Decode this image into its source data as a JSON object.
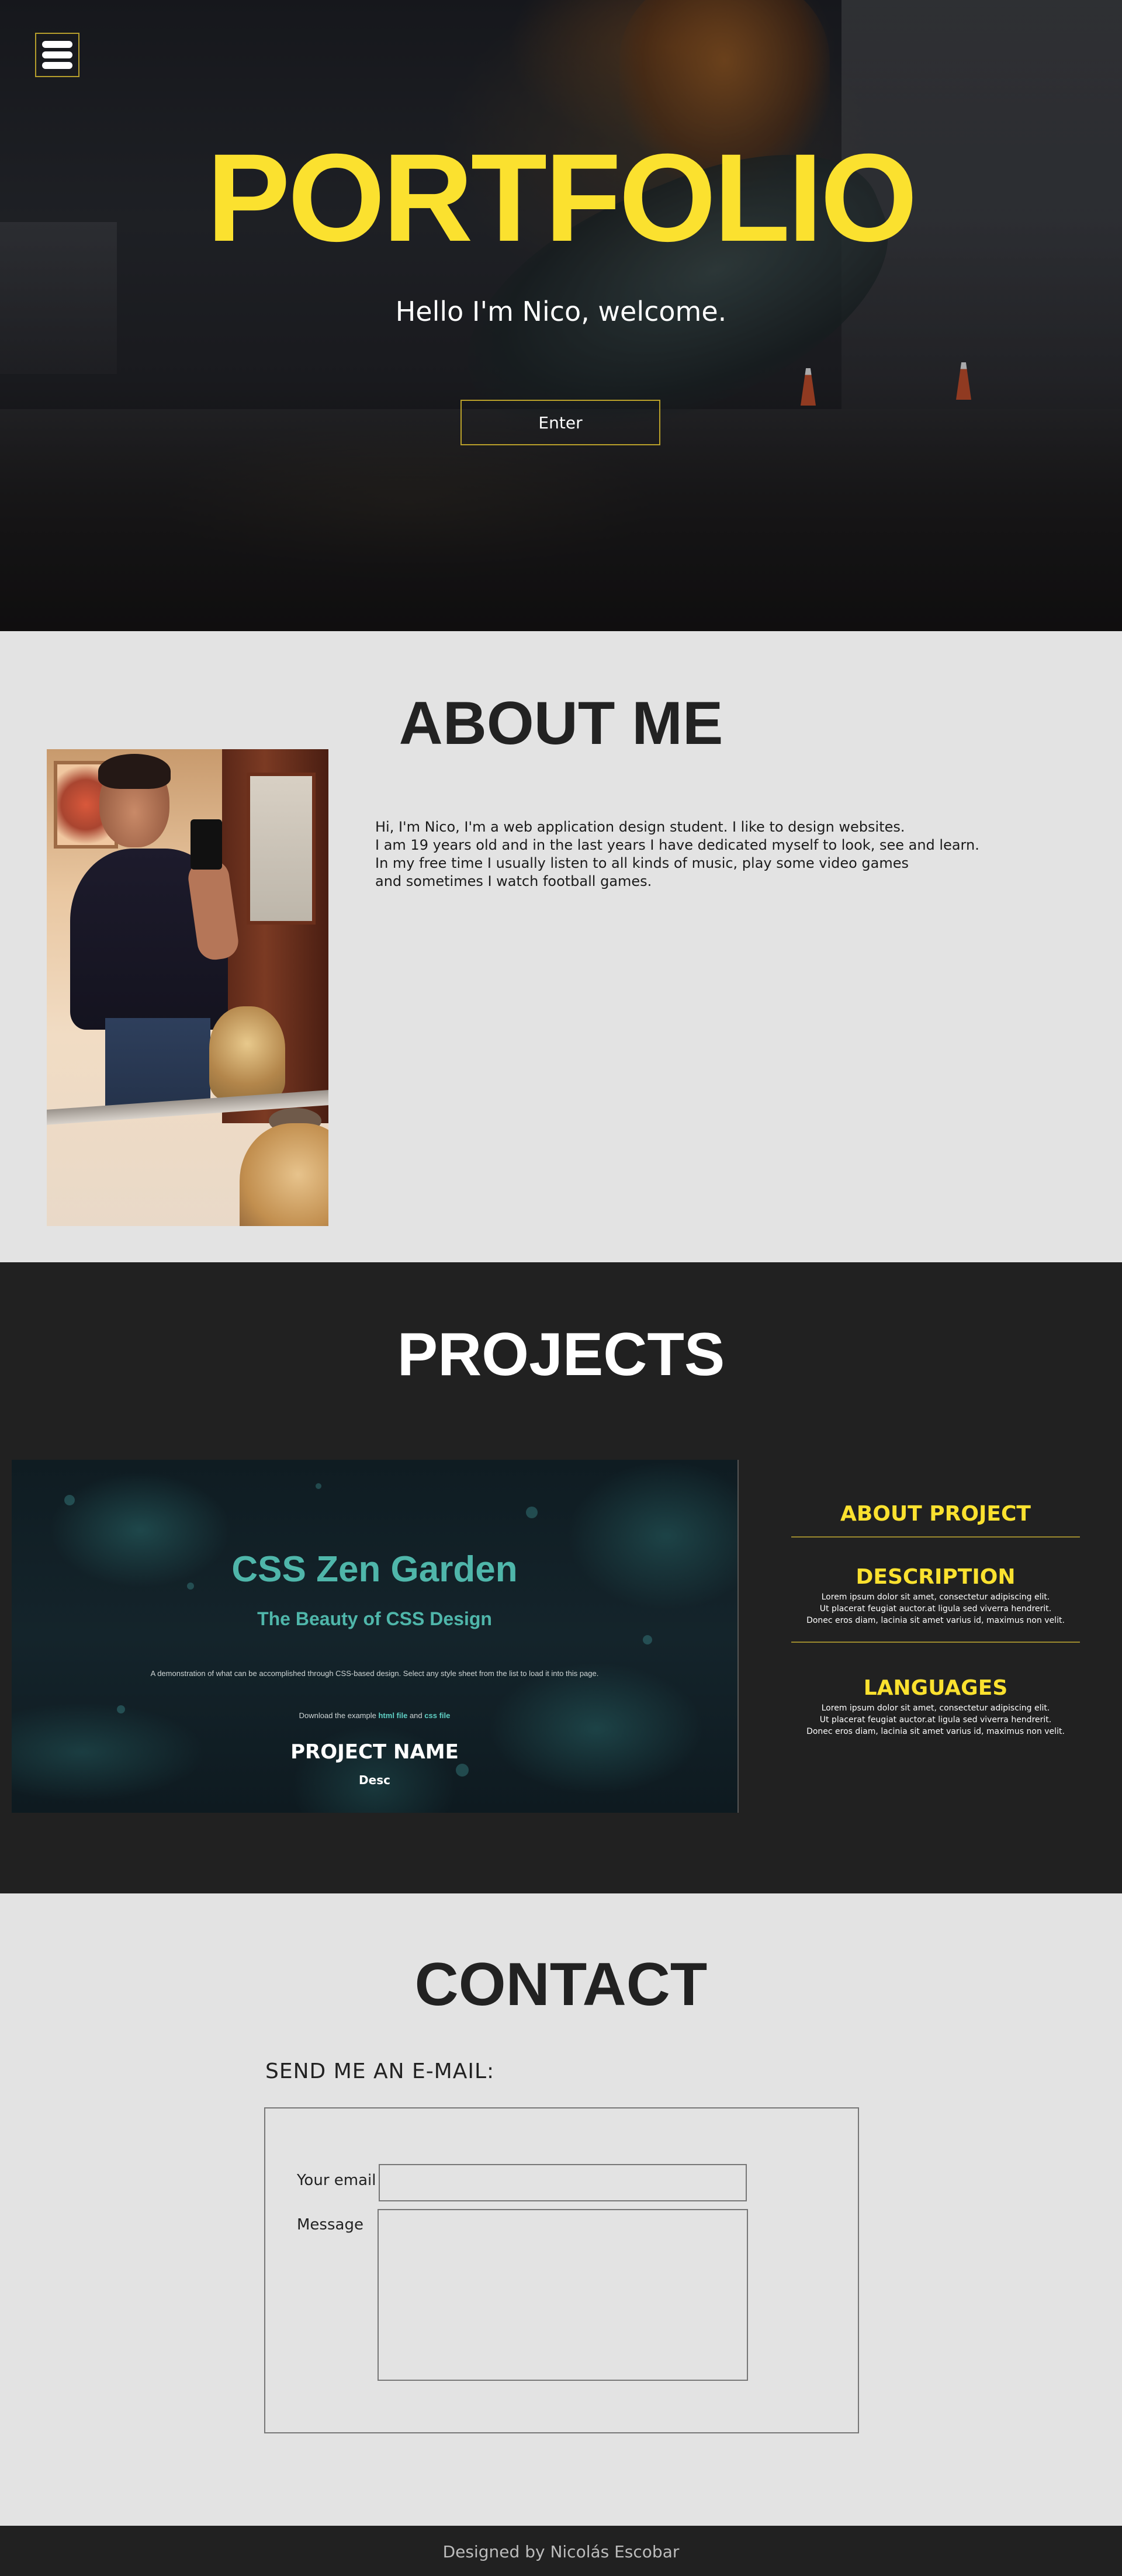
{
  "hero": {
    "title": "PORTFOLIO",
    "subtitle": "Hello I'm Nico, welcome.",
    "enter_label": "Enter",
    "menu_icon": "hamburger-menu-icon"
  },
  "about": {
    "title": "ABOUT ME",
    "lines": [
      "Hi, I'm Nico, I'm a web application design student. I like to design websites.",
      "I am 19 years old and in the last years I have dedicated myself to look, see and learn.",
      "In my free time I usually listen to all kinds of music, play some video games",
      "and sometimes I watch football games."
    ]
  },
  "projects": {
    "title": "PROJECTS",
    "card": {
      "screenshot_title": "CSS Zen Garden",
      "screenshot_subtitle": "The Beauty of CSS Design",
      "screenshot_desc": "A demonstration of what can be accomplished through CSS-based design. Select any style sheet from the list to load it into this page.",
      "screenshot_download_prefix": "Download the example",
      "screenshot_html_link": "html file",
      "screenshot_and": "and",
      "screenshot_css_link": "css file",
      "name": "PROJECT NAME",
      "desc": "Desc"
    },
    "info": {
      "about_heading": "ABOUT PROJECT",
      "description_heading": "DESCRIPTION",
      "description_lines": [
        "Lorem ipsum dolor sit amet, consectetur adipiscing elit.",
        "Ut placerat feugiat auctor.at ligula sed viverra hendrerit.",
        "Donec eros diam, lacinia sit amet varius id, maximus non velit."
      ],
      "languages_heading": "LANGUAGES",
      "languages_lines": [
        "Lorem ipsum dolor sit amet, consectetur adipiscing elit.",
        "Ut placerat feugiat auctor.at ligula sed viverra hendrerit.",
        "Donec eros diam, lacinia sit amet varius id, maximus non velit."
      ]
    }
  },
  "contact": {
    "title": "CONTACT",
    "send_label": "SEND ME AN E-MAIL:",
    "email_label": "Your email",
    "message_label": "Message",
    "email_value": "",
    "message_value": ""
  },
  "footer": {
    "text": "Designed by Nicolás Escobar"
  },
  "colors": {
    "accent_yellow": "#fbe12f",
    "dark_bg": "#212121",
    "light_bg": "#e3e3e3",
    "zen_teal": "#4fb6aa"
  }
}
